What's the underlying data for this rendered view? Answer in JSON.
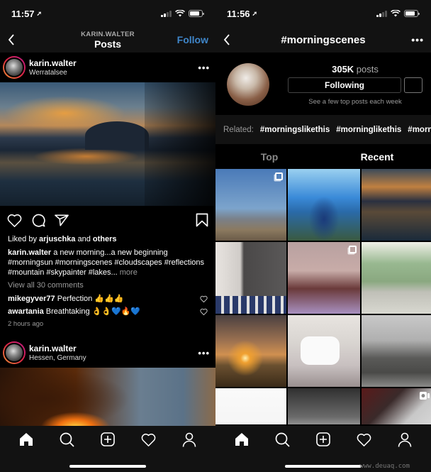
{
  "left": {
    "status": {
      "time": "11:57"
    },
    "nav": {
      "subtitle": "KARIN.WALTER",
      "title": "Posts",
      "follow_label": "Follow"
    },
    "post1": {
      "username": "karin.walter",
      "location": "Werratalsee",
      "likes_prefix": "Liked by ",
      "liked_by": "arjuschka",
      "likes_and": " and ",
      "likes_others": "others",
      "caption_user": "karin.walter",
      "caption_text": " a new morning...a new beginning #morningsun #morningscenes #cloudscapes #reflections #mountain #skypainter #lakes...",
      "caption_more": " more",
      "view_comments": "View all 30 comments",
      "comments": [
        {
          "user": "mikegyver77",
          "text": " Perfection 👍👍👍"
        },
        {
          "user": "awartania",
          "text": " Breathtaking 👌👌💙🔥💙"
        }
      ],
      "time_ago": "2 hours ago"
    },
    "post2": {
      "username": "karin.walter",
      "location": "Hessen, Germany"
    }
  },
  "right": {
    "status": {
      "time": "11:56"
    },
    "nav": {
      "title": "#morningscenes"
    },
    "tag": {
      "count": "305K",
      "count_label": " posts",
      "following_label": "Following",
      "note": "See a few top posts each week"
    },
    "related": {
      "label": "Related:",
      "tags": [
        "#morningslikethis",
        "#morninglikethis",
        "#morningsun"
      ]
    },
    "tabs": {
      "top": "Top",
      "recent": "Recent",
      "active": "Recent"
    },
    "grid": [
      {
        "desc": "city skyline blue sky",
        "badge": "multiple"
      },
      {
        "desc": "man in blue hoodie misty hill",
        "badge": ""
      },
      {
        "desc": "lake sunset with mountain",
        "badge": ""
      },
      {
        "desc": "bedroom with mountain wall mural",
        "badge": ""
      },
      {
        "desc": "pink building facade",
        "badge": "multiple"
      },
      {
        "desc": "two children sitting on steps",
        "badge": ""
      },
      {
        "desc": "sunrise over field",
        "badge": ""
      },
      {
        "desc": "white slippers on bed",
        "badge": ""
      },
      {
        "desc": "city square with cathedral",
        "badge": ""
      },
      {
        "desc": "white sketch paper",
        "badge": ""
      },
      {
        "desc": "old town street",
        "badge": ""
      },
      {
        "desc": "ceiling lights",
        "badge": "video"
      }
    ]
  },
  "tabbar": {
    "items": [
      "home",
      "search",
      "new-post",
      "activity",
      "profile"
    ]
  },
  "watermark": "www.deuaq.com"
}
